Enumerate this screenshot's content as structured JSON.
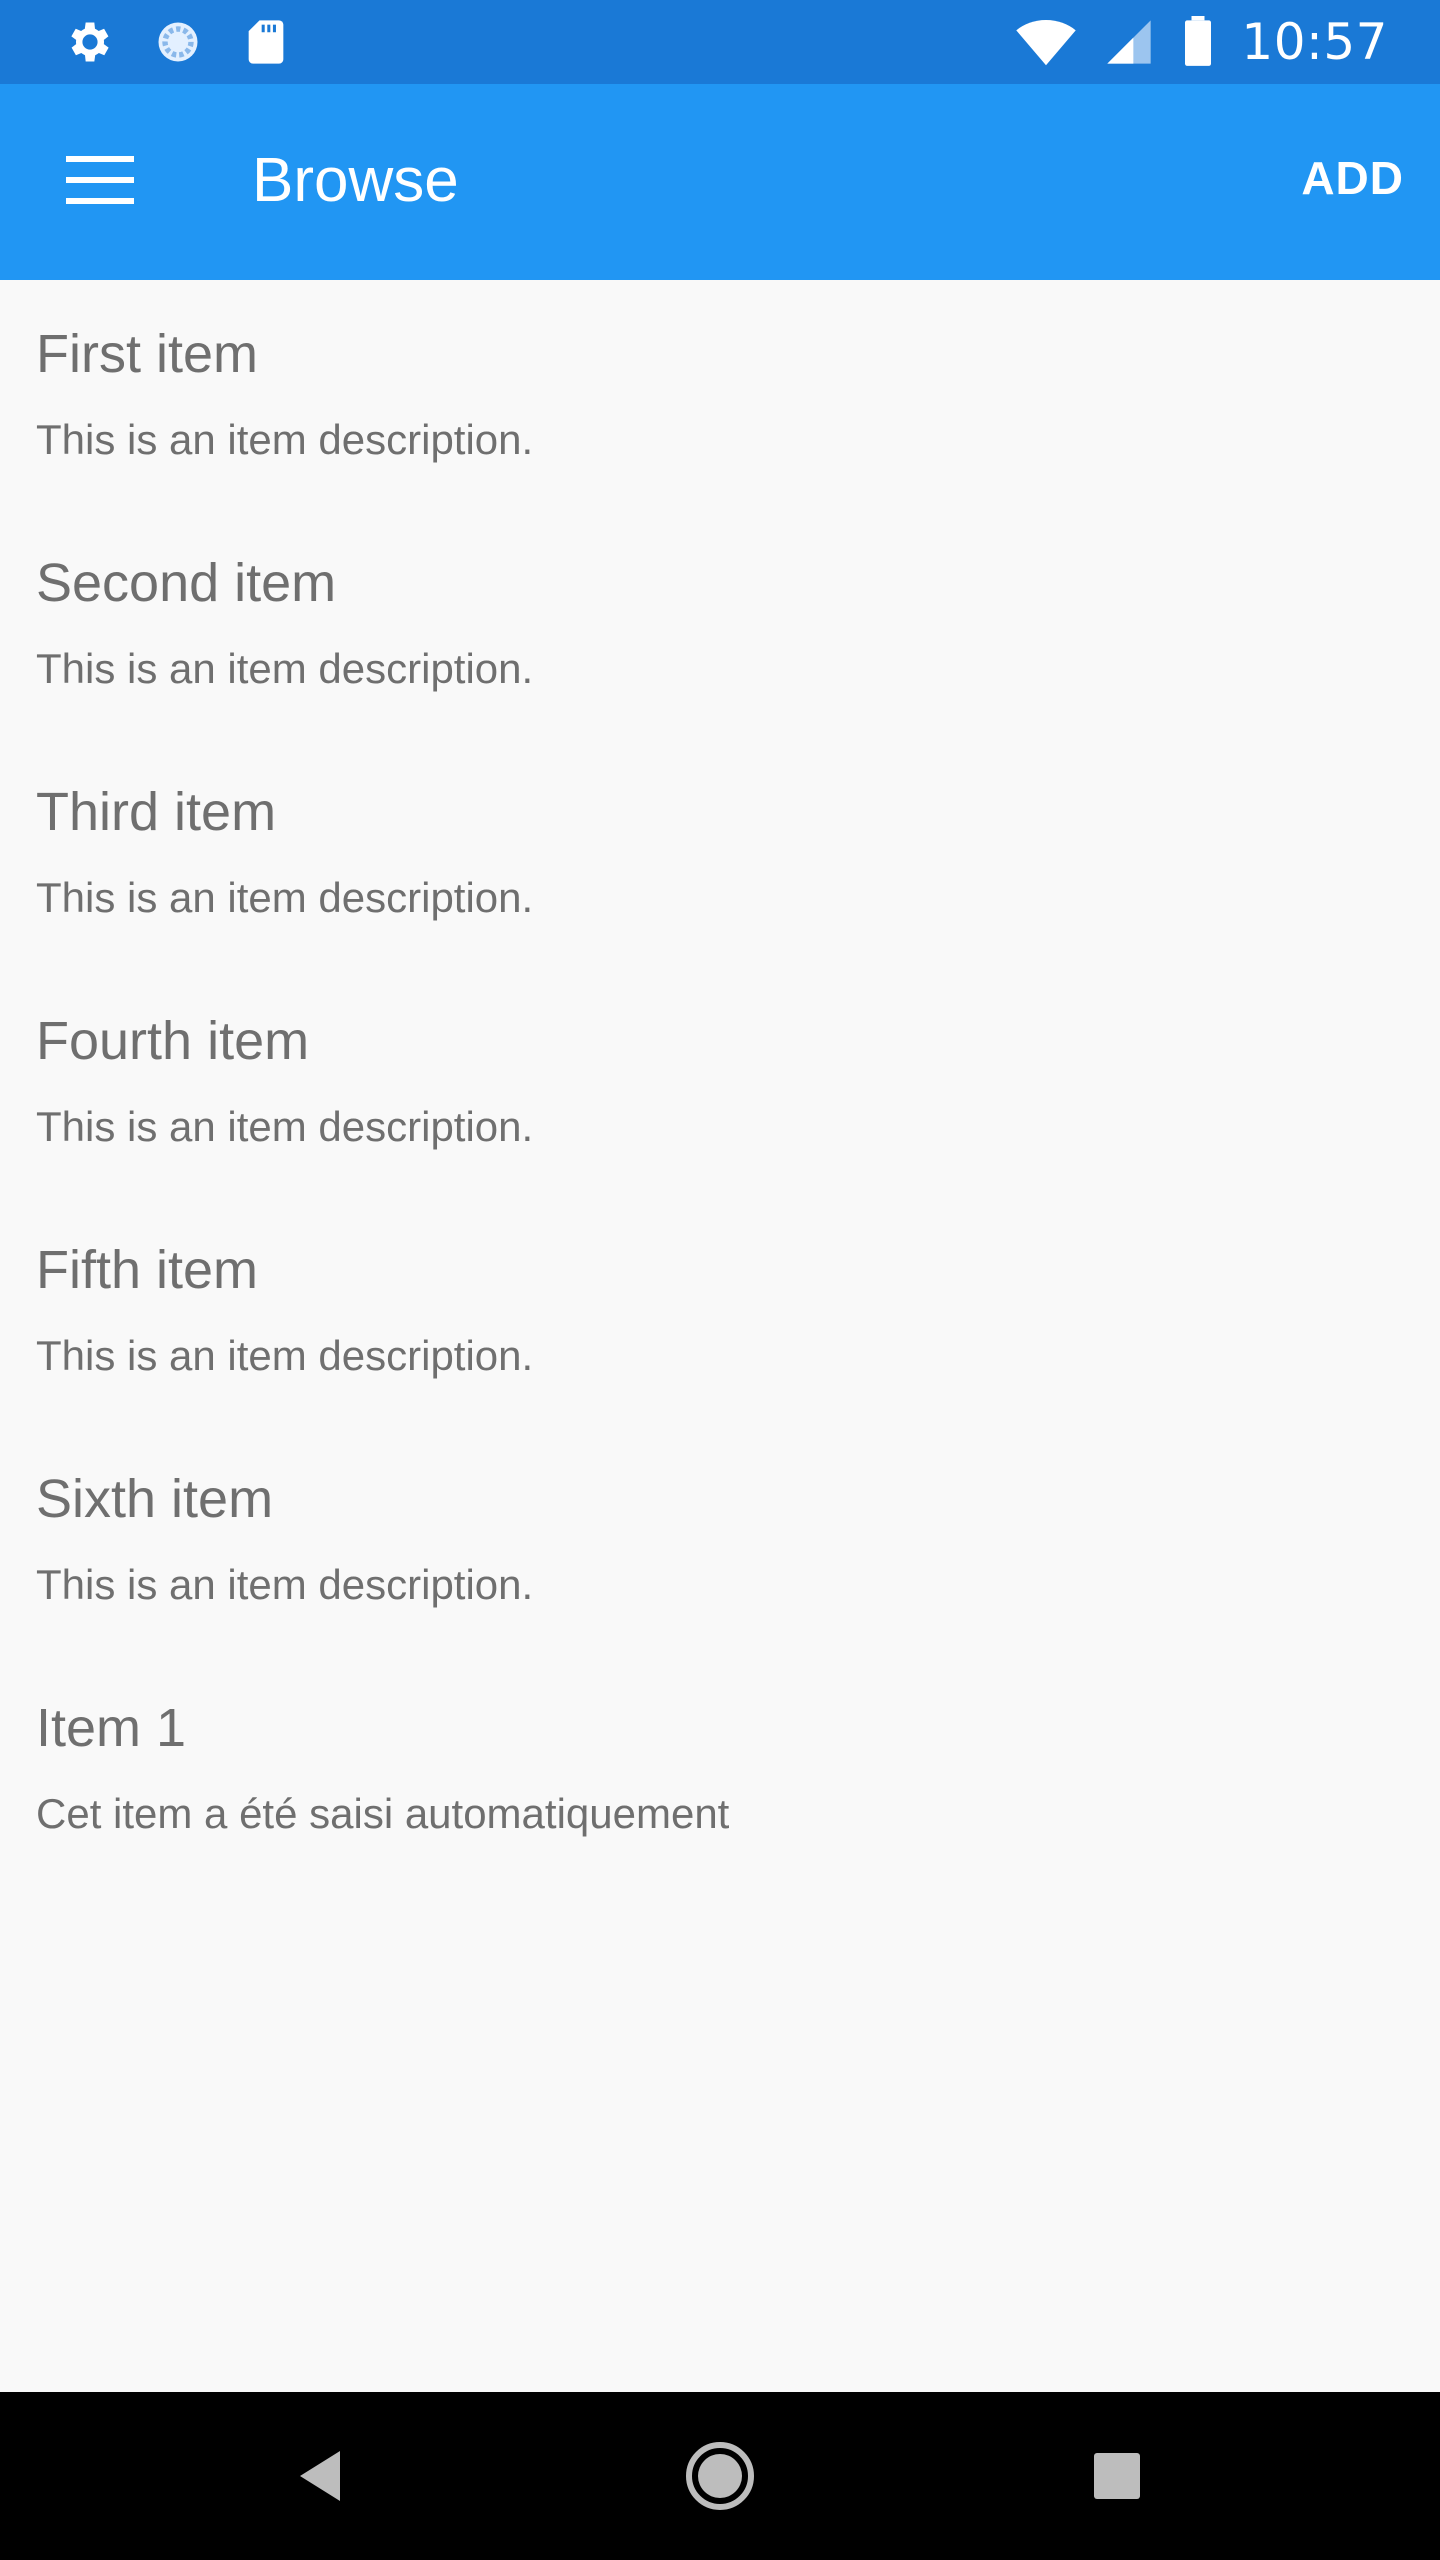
{
  "status_bar": {
    "time": "10:57",
    "left_icons": [
      "gear-icon",
      "sync-icon",
      "sd-card-icon"
    ],
    "right_icons": [
      "wifi-icon",
      "cellular-signal-icon",
      "battery-icon"
    ]
  },
  "app_bar": {
    "title": "Browse",
    "action_label": "ADD",
    "menu_icon": "hamburger-menu-icon",
    "color": "#2196f3",
    "status_color": "#1a79d6"
  },
  "items": [
    {
      "title": "First item",
      "description": "This is an item description."
    },
    {
      "title": "Second item",
      "description": "This is an item description."
    },
    {
      "title": "Third item",
      "description": "This is an item description."
    },
    {
      "title": "Fourth item",
      "description": "This is an item description."
    },
    {
      "title": "Fifth item",
      "description": "This is an item description."
    },
    {
      "title": "Sixth item",
      "description": "This is an item description."
    },
    {
      "title": "Item 1",
      "description": "Cet item a été saisi automatiquement"
    }
  ],
  "nav_bar": {
    "buttons": [
      "back-icon",
      "home-icon",
      "recents-icon"
    ]
  }
}
